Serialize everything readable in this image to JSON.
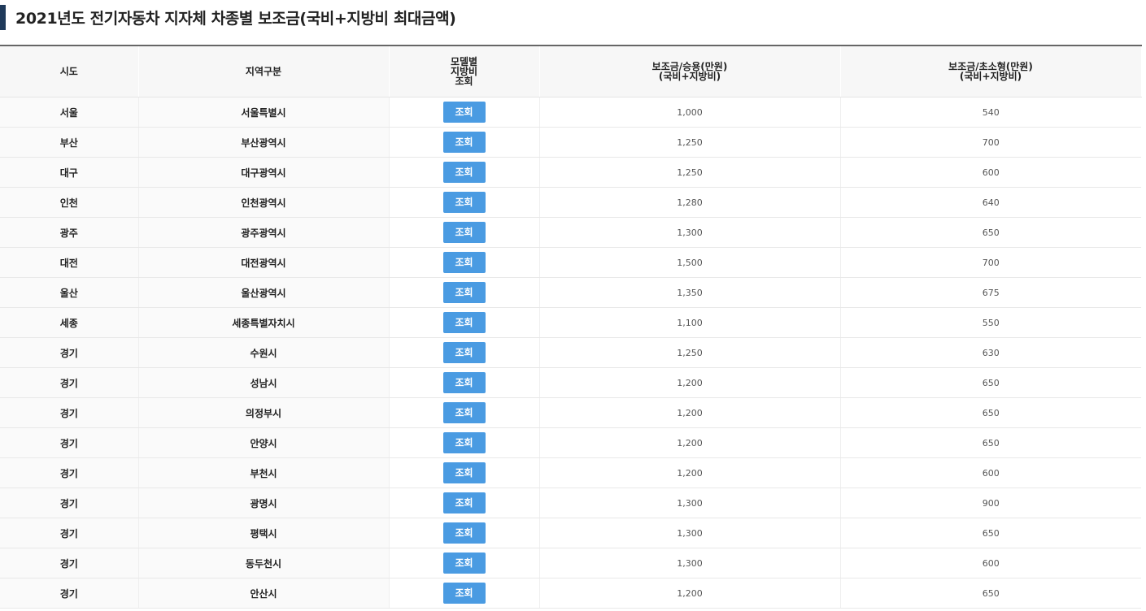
{
  "page": {
    "title": "2021년도 전기자동차 지자체 차종별 보조금(국비+지방비 최대금액)"
  },
  "table": {
    "headers": {
      "sido": "시도",
      "region": "지역구분",
      "model": "모델별\n지방비\n조회",
      "passenger": "보조금/승용(만원)\n(국비+지방비)",
      "micro": "보조금/초소형(만원)\n(국비+지방비)"
    },
    "button_label": "조회",
    "rows": [
      {
        "sido": "서울",
        "region": "서울특별시",
        "passenger": "1,000",
        "micro": "540"
      },
      {
        "sido": "부산",
        "region": "부산광역시",
        "passenger": "1,250",
        "micro": "700"
      },
      {
        "sido": "대구",
        "region": "대구광역시",
        "passenger": "1,250",
        "micro": "600"
      },
      {
        "sido": "인천",
        "region": "인천광역시",
        "passenger": "1,280",
        "micro": "640"
      },
      {
        "sido": "광주",
        "region": "광주광역시",
        "passenger": "1,300",
        "micro": "650"
      },
      {
        "sido": "대전",
        "region": "대전광역시",
        "passenger": "1,500",
        "micro": "700"
      },
      {
        "sido": "울산",
        "region": "울산광역시",
        "passenger": "1,350",
        "micro": "675"
      },
      {
        "sido": "세종",
        "region": "세종특별자치시",
        "passenger": "1,100",
        "micro": "550"
      },
      {
        "sido": "경기",
        "region": "수원시",
        "passenger": "1,250",
        "micro": "630"
      },
      {
        "sido": "경기",
        "region": "성남시",
        "passenger": "1,200",
        "micro": "650"
      },
      {
        "sido": "경기",
        "region": "의정부시",
        "passenger": "1,200",
        "micro": "650"
      },
      {
        "sido": "경기",
        "region": "안양시",
        "passenger": "1,200",
        "micro": "650"
      },
      {
        "sido": "경기",
        "region": "부천시",
        "passenger": "1,200",
        "micro": "600"
      },
      {
        "sido": "경기",
        "region": "광명시",
        "passenger": "1,300",
        "micro": "900"
      },
      {
        "sido": "경기",
        "region": "평택시",
        "passenger": "1,300",
        "micro": "650"
      },
      {
        "sido": "경기",
        "region": "동두천시",
        "passenger": "1,300",
        "micro": "600"
      },
      {
        "sido": "경기",
        "region": "안산시",
        "passenger": "1,200",
        "micro": "650"
      }
    ]
  }
}
